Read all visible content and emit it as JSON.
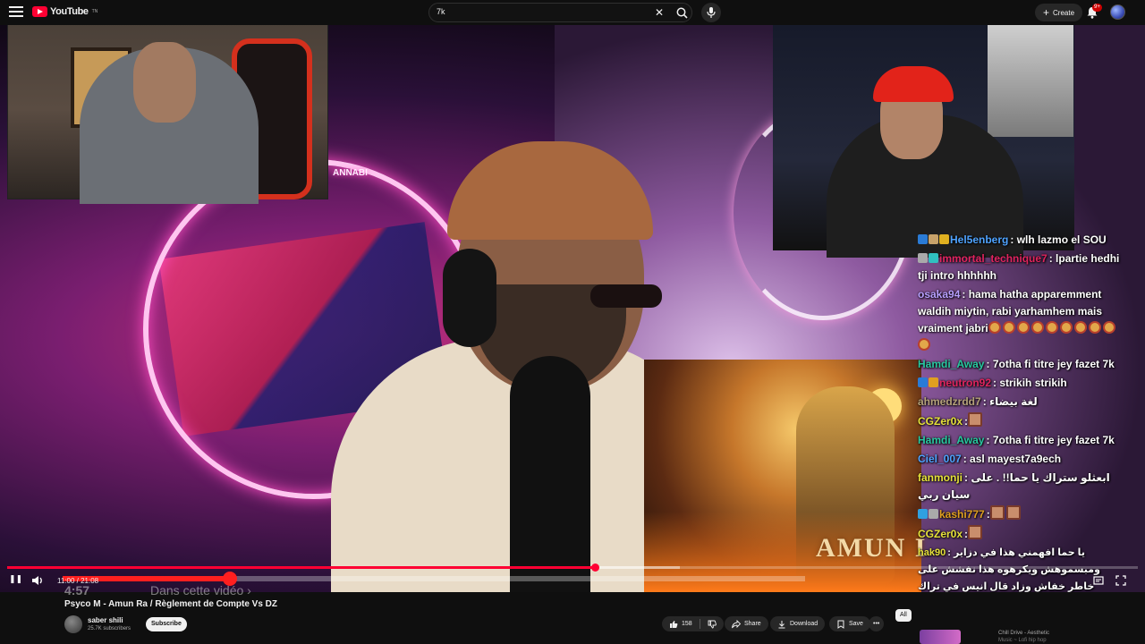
{
  "masthead": {
    "logo_text": "YouTube",
    "logo_tm": "TN",
    "search_value": "7k",
    "search_placeholder": "Search",
    "clear_glyph": "✕",
    "create_label": "Create",
    "notification_count": "9+"
  },
  "player": {
    "overlay_text": "ANNABI",
    "album_title": "AMUN I",
    "current_time": "11:00",
    "duration": "21:08",
    "time_display": "11:00 / 21:08",
    "chapter_time": "4:57",
    "chapter_prompt": "Dans cette vidéo ›",
    "progress": 0.52,
    "buffered": 0.595,
    "overlay_progress": 0.225
  },
  "chat": [
    {
      "user": "Hel5enberg",
      "user_color": "#4fa3ff",
      "text": ": wlh lazmo el SOU",
      "badges": [
        "#2a7bd6",
        "#c8a26a",
        "#e0b020"
      ]
    },
    {
      "user": "immortal_technique7",
      "user_color": "#e0245e",
      "text": ": lpartie hedhi tji intro hhhhhh",
      "badges": [
        "#aaaaaa",
        "#30c0c0"
      ]
    },
    {
      "user": "osaka94",
      "user_color": "#b8a0ff",
      "text": ": hama hatha apparemment waldih miytin, rabi yarhamhem mais vraiment jabri",
      "emotes": 10
    },
    {
      "user": "Hamdi_Away",
      "user_color": "#28c8a0",
      "text": ": 7otha fi titre jey fazet 7k",
      "badges": []
    },
    {
      "user": "neutron92",
      "user_color": "#e0245e",
      "text": ": strikih strikih",
      "badges": [
        "#2a7bd6",
        "#e0a020"
      ]
    },
    {
      "user": "ahmedzrdd7",
      "user_color": "#b5a27a",
      "text": ": لغة بيضاء",
      "badges": []
    },
    {
      "user": "CGZer0x",
      "user_color": "#e6e23a",
      "text": ":",
      "emotes_sq": 1
    },
    {
      "user": "Hamdi_Away",
      "user_color": "#28c8a0",
      "text": ": 7otha fi titre jey fazet 7k",
      "badges": []
    },
    {
      "user": "Ciel_007",
      "user_color": "#4fa3ff",
      "text": ": asl mayest7a9ech",
      "badges": []
    },
    {
      "user": "fanmonji",
      "user_color": "#e6e23a",
      "text": ": ابعثلو ستراك يا حما!! . على سيان ربي",
      "badges": []
    },
    {
      "user": "kashi777",
      "user_color": "#e0a020",
      "text": ":",
      "badges": [
        "#30a0e0",
        "#aaaaaa"
      ],
      "emotes_sq": 2
    },
    {
      "user": "CGZer0x",
      "user_color": "#e6e23a",
      "text": ":",
      "emotes_sq": 1
    },
    {
      "user": "hak90",
      "user_color": "#e6e23a",
      "text": ": يا حما افهمني هذا في دزاير ومبسموهش ويكرهوه هذا نفشش على خاطر خفاش وزاد قال انيس في تراك كفاش عبد خلقو تشبهو بالخفاش سمع تراك هو تحل جعبو قال ! بريكلامي عليا أيا بدا يحل في جعبو ييلبيك دزيري يحبك حما هذا يخلق في"
    }
  ],
  "controls": {
    "play_pause_glyph": "❚❚",
    "volume_glyph": "🔊"
  },
  "video": {
    "title": "Psyco M - Amun Ra / Règlement de Compte Vs DZ",
    "channel_name": "saber shili",
    "subscribers": "25.7K subscribers",
    "subscribe_label": "Subscribe",
    "like_count": "158",
    "share_label": "Share",
    "download_label": "Download",
    "save_label": "Save",
    "more_label": "•••"
  },
  "sidebar": {
    "chip_all": "All",
    "rec_title": "Chill Drive - Aesthetic",
    "rec_sub": "Music ~ Lofi hip hop"
  },
  "colors": {
    "brand_red": "#ff0033",
    "background": "#0f0f0f",
    "pill": "#272727"
  }
}
